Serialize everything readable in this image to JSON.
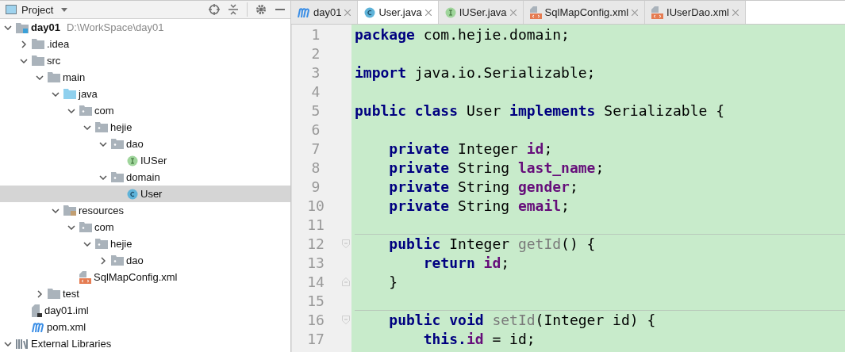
{
  "project_panel": {
    "title": "Project"
  },
  "tree": [
    {
      "label": "day01",
      "hint": "D:\\WorkSpace\\day01",
      "kind": "module",
      "expanded": true,
      "selected": false,
      "children": [
        {
          "label": ".idea",
          "kind": "folder",
          "expanded": false,
          "selected": false
        },
        {
          "label": "src",
          "kind": "folder",
          "expanded": true,
          "selected": false,
          "children": [
            {
              "label": "main",
              "kind": "folder",
              "expanded": true,
              "selected": false,
              "children": [
                {
                  "label": "java",
                  "kind": "source-folder",
                  "expanded": true,
                  "selected": false,
                  "children": [
                    {
                      "label": "com",
                      "kind": "package",
                      "expanded": true,
                      "selected": false,
                      "children": [
                        {
                          "label": "hejie",
                          "kind": "package",
                          "expanded": true,
                          "selected": false,
                          "children": [
                            {
                              "label": "dao",
                              "kind": "package",
                              "expanded": true,
                              "selected": false,
                              "children": [
                                {
                                  "label": "IUSer",
                                  "kind": "interface",
                                  "selected": false
                                }
                              ]
                            },
                            {
                              "label": "domain",
                              "kind": "package",
                              "expanded": true,
                              "selected": false,
                              "children": [
                                {
                                  "label": "User",
                                  "kind": "class",
                                  "selected": true
                                }
                              ]
                            }
                          ]
                        }
                      ]
                    }
                  ]
                },
                {
                  "label": "resources",
                  "kind": "resources",
                  "expanded": true,
                  "selected": false,
                  "children": [
                    {
                      "label": "com",
                      "kind": "package",
                      "expanded": true,
                      "selected": false,
                      "children": [
                        {
                          "label": "hejie",
                          "kind": "package",
                          "expanded": true,
                          "selected": false,
                          "children": [
                            {
                              "label": "dao",
                              "kind": "package",
                              "expanded": false,
                              "selected": false
                            }
                          ]
                        }
                      ]
                    },
                    {
                      "label": "SqlMapConfig.xml",
                      "kind": "xml",
                      "selected": false
                    }
                  ]
                }
              ]
            },
            {
              "label": "test",
              "kind": "folder",
              "expanded": false,
              "selected": false
            }
          ]
        },
        {
          "label": "day01.iml",
          "kind": "iml",
          "selected": false
        },
        {
          "label": "pom.xml",
          "kind": "maven",
          "selected": false
        }
      ]
    },
    {
      "label": "External Libraries",
      "kind": "libraries",
      "expanded": true,
      "selected": false
    }
  ],
  "tabs": [
    {
      "label": "day01",
      "kind": "maven",
      "selected": false
    },
    {
      "label": "User.java",
      "kind": "class",
      "selected": true
    },
    {
      "label": "IUSer.java",
      "kind": "interface",
      "selected": false
    },
    {
      "label": "SqlMapConfig.xml",
      "kind": "xml",
      "selected": false
    },
    {
      "label": "IUserDao.xml",
      "kind": "xml",
      "selected": false
    }
  ],
  "code": [
    {
      "number": "1",
      "tokens": [
        {
          "kind": "keyword",
          "text": "package"
        },
        {
          "kind": "plain",
          "text": " com.hejie.domain;"
        }
      ]
    },
    {
      "number": "2"
    },
    {
      "number": "3",
      "tokens": [
        {
          "kind": "keyword",
          "text": "import"
        },
        {
          "kind": "plain",
          "text": " java.io.Serializable;"
        }
      ]
    },
    {
      "number": "4"
    },
    {
      "number": "5",
      "tokens": [
        {
          "kind": "keyword",
          "text": "public class"
        },
        {
          "kind": "plain",
          "text": " User "
        },
        {
          "kind": "keyword",
          "text": "implements"
        },
        {
          "kind": "plain",
          "text": " Serializable {"
        }
      ]
    },
    {
      "number": "6"
    },
    {
      "number": "7",
      "tokens": [
        {
          "kind": "keyword",
          "text": "    private"
        },
        {
          "kind": "plain",
          "text": " Integer "
        },
        {
          "kind": "field",
          "text": "id"
        },
        {
          "kind": "plain",
          "text": ";"
        }
      ]
    },
    {
      "number": "8",
      "tokens": [
        {
          "kind": "keyword",
          "text": "    private"
        },
        {
          "kind": "plain",
          "text": " String "
        },
        {
          "kind": "field",
          "text": "last_name"
        },
        {
          "kind": "plain",
          "text": ";"
        }
      ]
    },
    {
      "number": "9",
      "tokens": [
        {
          "kind": "keyword",
          "text": "    private"
        },
        {
          "kind": "plain",
          "text": " String "
        },
        {
          "kind": "field",
          "text": "gender"
        },
        {
          "kind": "plain",
          "text": ";"
        }
      ]
    },
    {
      "number": "10",
      "tokens": [
        {
          "kind": "keyword",
          "text": "    private"
        },
        {
          "kind": "plain",
          "text": " String "
        },
        {
          "kind": "field",
          "text": "email"
        },
        {
          "kind": "plain",
          "text": ";"
        }
      ]
    },
    {
      "number": "11"
    },
    {
      "number": "12",
      "separator": true,
      "fold_start": true,
      "tokens": [
        {
          "kind": "keyword",
          "text": "    public"
        },
        {
          "kind": "plain",
          "text": " Integer "
        },
        {
          "kind": "method",
          "text": "getId"
        },
        {
          "kind": "plain",
          "text": "() {"
        }
      ]
    },
    {
      "number": "13",
      "tokens": [
        {
          "kind": "keyword",
          "text": "        return "
        },
        {
          "kind": "field",
          "text": "id"
        },
        {
          "kind": "plain",
          "text": ";"
        }
      ]
    },
    {
      "number": "14",
      "fold_end": true,
      "tokens": [
        {
          "kind": "plain",
          "text": "    }"
        }
      ]
    },
    {
      "number": "15"
    },
    {
      "number": "16",
      "separator": true,
      "fold_start": true,
      "tokens": [
        {
          "kind": "keyword",
          "text": "    public void "
        },
        {
          "kind": "method",
          "text": "setId"
        },
        {
          "kind": "plain",
          "text": "(Integer id) {"
        }
      ]
    },
    {
      "number": "17",
      "tokens": [
        {
          "kind": "keyword",
          "text": "        this."
        },
        {
          "kind": "field",
          "text": "id"
        },
        {
          "kind": "plain",
          "text": " = id;"
        }
      ]
    }
  ]
}
